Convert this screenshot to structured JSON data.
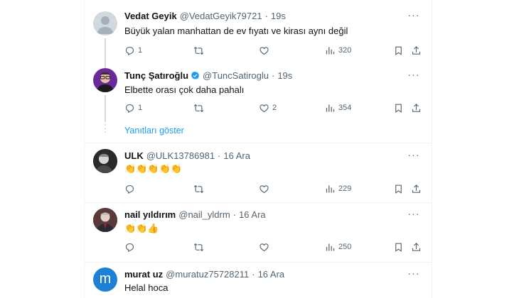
{
  "tweets": [
    {
      "name": "Vedat Geyik",
      "handle": "@VedatGeyik79721",
      "time": "19s",
      "text": "Büyük yalan manhattan de ev fıyatı ve kirası aynı değil",
      "replies": "1",
      "retweets": "",
      "likes": "",
      "views": "320"
    },
    {
      "name": "Tunç Şatıroğlu",
      "handle": "@TuncSatiroglu",
      "time": "19s",
      "text": "Elbette orası çok daha pahalı",
      "replies": "1",
      "retweets": "",
      "likes": "2",
      "views": "354"
    },
    {
      "name": "ULK",
      "handle": "@ULK13786981",
      "time": "16 Ara",
      "text": "👏👏👏👏👏",
      "replies": "",
      "retweets": "",
      "likes": "",
      "views": "229"
    },
    {
      "name": "nail yıldırım",
      "handle": "@nail_yldrm",
      "time": "16 Ara",
      "text": "👏👏👍",
      "replies": "",
      "retweets": "",
      "likes": "",
      "views": "250"
    },
    {
      "name": "murat uz",
      "handle": "@muratuz75728211",
      "time": "16 Ara",
      "text": "Helal hoca",
      "avatar_letter": "m"
    }
  ],
  "show_replies_label": "Yanıtları göster",
  "separator": "·",
  "more_label": "···",
  "colors": {
    "accent": "#1d9bf0",
    "muted": "#536471",
    "text": "#0f1419",
    "avatar_m": "#1d7fd6"
  },
  "icons": {
    "reply": "reply-icon",
    "retweet": "retweet-icon",
    "like": "heart-icon",
    "views": "views-icon",
    "bookmark": "bookmark-icon",
    "share": "share-icon",
    "verified": "verified-badge-icon",
    "more": "more-icon"
  }
}
